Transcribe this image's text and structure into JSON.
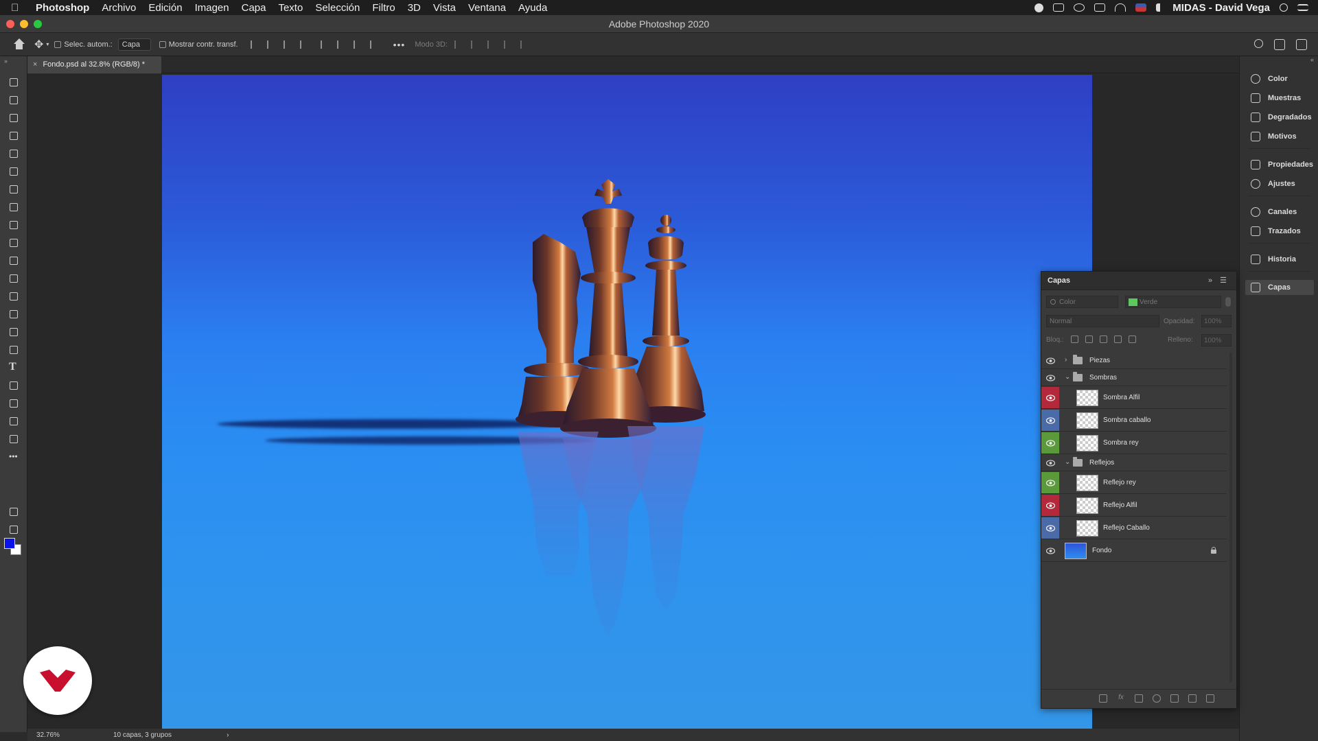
{
  "menubar": {
    "app": "Photoshop",
    "items": [
      "Archivo",
      "Edición",
      "Imagen",
      "Capa",
      "Texto",
      "Selección",
      "Filtro",
      "3D",
      "Vista",
      "Ventana",
      "Ayuda"
    ],
    "user": "MIDAS - David Vega"
  },
  "window": {
    "title": "Adobe Photoshop 2020"
  },
  "options": {
    "auto_select_label": "Selec. autom.:",
    "auto_select_value": "Capa",
    "show_transform_label": "Mostrar contr. transf.",
    "mode3d_label": "Modo 3D:",
    "more": "•••"
  },
  "document_tab": {
    "close": "×",
    "label": "Fondo.psd al 32.8% (RGB/8) *"
  },
  "status": {
    "zoom": "32.76%",
    "info": "10 capas, 3 grupos",
    "arrow": "›"
  },
  "colors": {
    "foreground": "#0a14e8",
    "background": "#ffffff",
    "accent_red": "#c8102e"
  },
  "dock": {
    "items": [
      {
        "label": "Color",
        "icon": "color-icon"
      },
      {
        "label": "Muestras",
        "icon": "swatches-icon"
      },
      {
        "label": "Degradados",
        "icon": "gradients-icon"
      },
      {
        "label": "Motivos",
        "icon": "patterns-icon"
      },
      {
        "label": "Propiedades",
        "icon": "properties-icon"
      },
      {
        "label": "Ajustes",
        "icon": "adjustments-icon"
      },
      {
        "label": "Canales",
        "icon": "channels-icon"
      },
      {
        "label": "Trazados",
        "icon": "paths-icon"
      },
      {
        "label": "Historia",
        "icon": "history-icon"
      },
      {
        "label": "Capas",
        "icon": "layers-icon"
      }
    ]
  },
  "layers_panel": {
    "title": "Capas",
    "filter_kind": "Color",
    "filter_color": "Verde",
    "filter_color_hex": "#5ec85e",
    "blend_mode": "Normal",
    "opacity_label": "Opacidad:",
    "opacity_value": "100%",
    "lock_label": "Bloq.:",
    "fill_label": "Relleno:",
    "fill_value": "100%",
    "layers": [
      {
        "name": "Piezas",
        "type": "group",
        "expanded": false,
        "color": "none"
      },
      {
        "name": "Sombras",
        "type": "group",
        "expanded": true,
        "color": "none"
      },
      {
        "name": "Sombra Alfil",
        "type": "layer",
        "color": "#b3283a"
      },
      {
        "name": "Sombra caballo",
        "type": "layer",
        "color": "#4a6aa8"
      },
      {
        "name": "Sombra rey",
        "type": "layer",
        "color": "#5a9a3a"
      },
      {
        "name": "Reflejos",
        "type": "group",
        "expanded": true,
        "color": "none"
      },
      {
        "name": "Reflejo rey",
        "type": "layer",
        "color": "#5a9a3a"
      },
      {
        "name": "Reflejo Alfil",
        "type": "layer",
        "color": "#b3283a"
      },
      {
        "name": "Reflejo Caballo",
        "type": "layer",
        "color": "#4a6aa8"
      },
      {
        "name": "Fondo",
        "type": "background",
        "color": "none",
        "locked": true
      }
    ]
  }
}
